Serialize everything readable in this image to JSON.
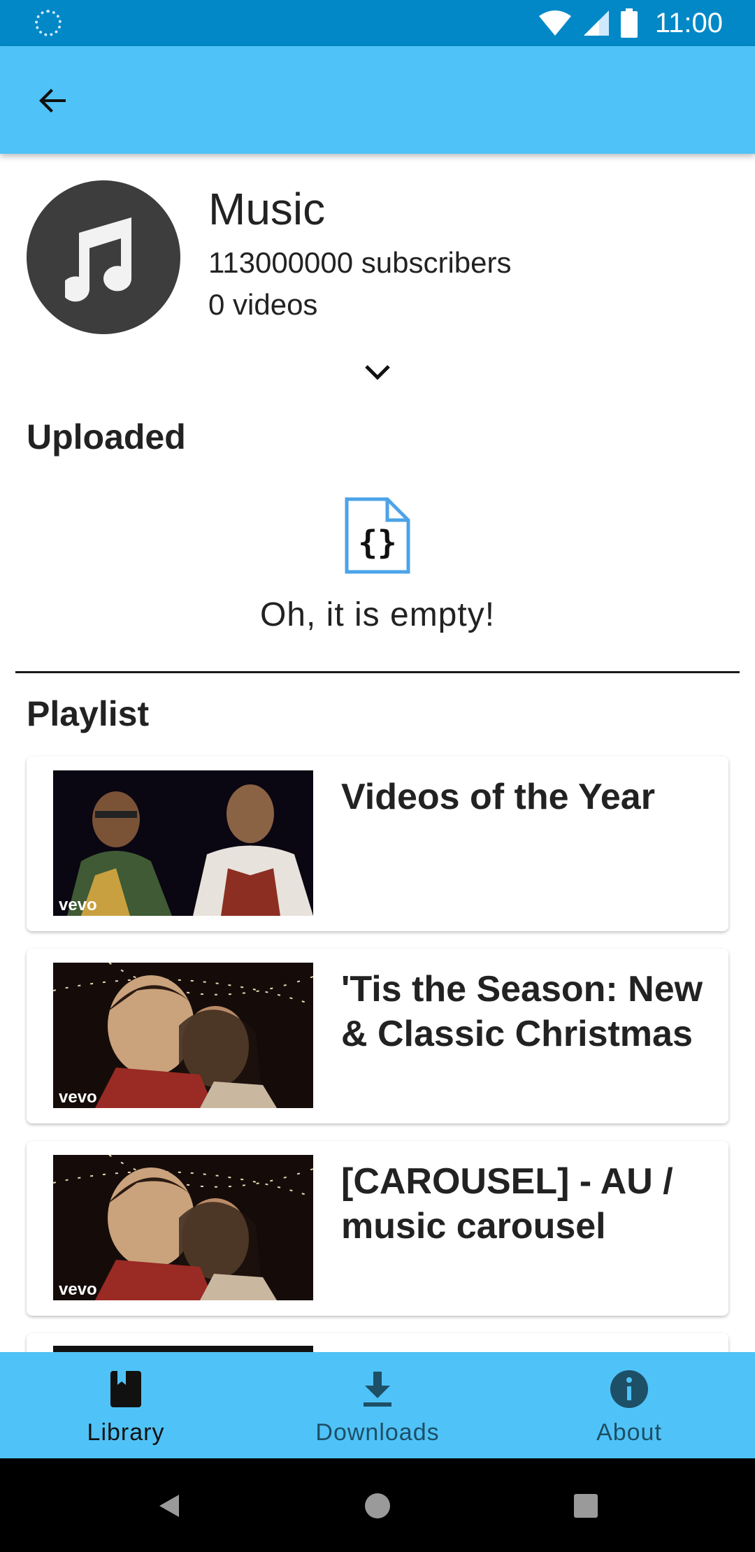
{
  "status_bar": {
    "time": "11:00"
  },
  "channel": {
    "name": "Music",
    "subscribers": "113000000 subscribers",
    "videos": "0 videos"
  },
  "sections": {
    "uploaded_title": "Uploaded",
    "empty_text": "Oh, it is empty!",
    "playlist_title": "Playlist"
  },
  "playlists": [
    {
      "title": "Videos of the Year",
      "badge": "vevo"
    },
    {
      "title": "'Tis the Season: New & Classic Christmas",
      "badge": "vevo"
    },
    {
      "title": "[CAROUSEL] - AU / music carousel",
      "badge": "vevo"
    }
  ],
  "bottom_nav": {
    "items": [
      {
        "label": "Library",
        "icon": "book-icon",
        "active": true
      },
      {
        "label": "Downloads",
        "icon": "download-icon",
        "active": false
      },
      {
        "label": "About",
        "icon": "info-icon",
        "active": false
      }
    ]
  },
  "colors": {
    "status_bar": "#0288c6",
    "app_bar": "#4fc3f7",
    "bottom_nav": "#4fc3f7",
    "empty_icon": "#4ca3e8"
  }
}
